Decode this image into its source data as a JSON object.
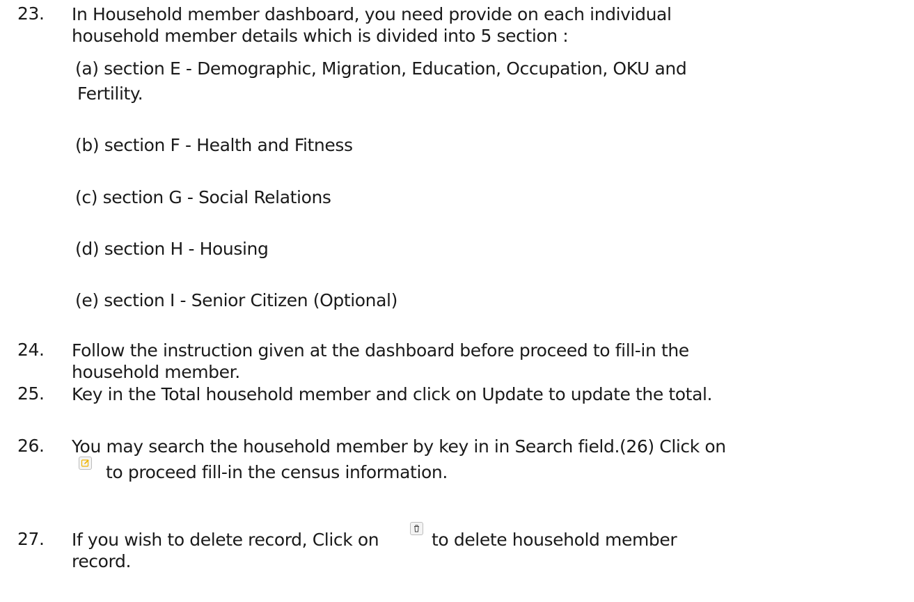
{
  "items": [
    {
      "number": "23.",
      "lines": [
        "In Household member dashboard, you need provide on each individual",
        "household member details which is divided into 5 section :"
      ],
      "subsections": [
        {
          "lines": [
            "(a) section E -  Demographic, Migration, Education, Occupation, OKU and",
            "Fertility."
          ]
        },
        {
          "lines": [
            "(b) section F -  Health and Fitness"
          ]
        },
        {
          "lines": [
            "(c) section G - Social Relations"
          ]
        },
        {
          "lines": [
            "(d) section H - Housing"
          ]
        },
        {
          "lines": [
            "(e) section I -   Senior Citizen (Optional)"
          ]
        }
      ]
    },
    {
      "number": "24.",
      "lines": [
        "Follow the instruction given at the dashboard before proceed to fill-in the",
        "household member."
      ]
    },
    {
      "number": "25.",
      "lines": [
        "Key in the Total household member and click on Update to update the total."
      ]
    },
    {
      "number": "26.",
      "lines": [
        "You may search the household member by key in in Search field.(26) Click on",
        "to proceed fill-in the census information."
      ],
      "icon": "edit-icon"
    },
    {
      "number": "27.",
      "line_before_icon": "If you wish to delete record, Click on",
      "line_after_icon": "to delete household member",
      "line2": "record.",
      "icon": "trash-icon"
    }
  ],
  "colors": {
    "text": "#1a1a1a",
    "edit_icon": "#f0b400",
    "trash_icon": "#444444"
  }
}
